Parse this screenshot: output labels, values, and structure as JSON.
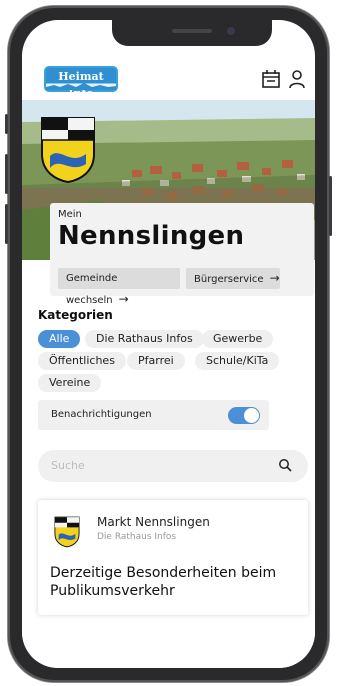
{
  "app": {
    "logo_text": "Heimat Info",
    "icons": {
      "calendar": "calendar-icon",
      "profile": "user-icon"
    }
  },
  "hero": {
    "image": "aerial-town-photo",
    "coat_of_arms": "coat-of-arms-icon"
  },
  "municipality": {
    "prefix": "Mein",
    "name": "Nennslingen",
    "buttons": [
      "Gemeinde wechseln",
      "Bürgerservice"
    ]
  },
  "categories": {
    "title": "Kategorien",
    "items": [
      "Alle",
      "Die Rathaus Infos",
      "Gewerbe",
      "Öffentliches",
      "Pfarrei",
      "Schule/KiTa",
      "Vereine"
    ],
    "active": "Alle"
  },
  "notifications": {
    "label": "Benachrichtigungen",
    "enabled": true
  },
  "search": {
    "placeholder": "Suche"
  },
  "news": [
    {
      "source": "Markt Nennslingen",
      "category": "Die Rathaus Infos",
      "title": "Derzeitige Besonderheiten beim Publikumsverkehr"
    }
  ],
  "colors": {
    "accent": "#4b8fd6",
    "logo": "#2f8fd0"
  }
}
